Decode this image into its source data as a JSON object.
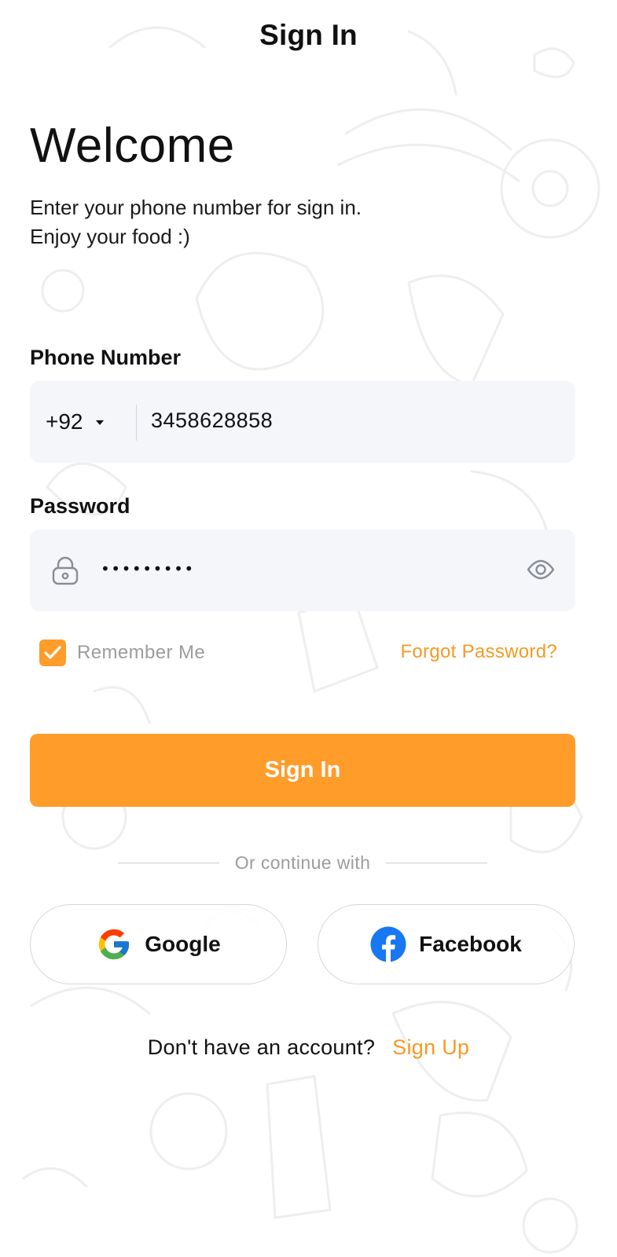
{
  "header": {
    "title": "Sign In"
  },
  "welcome": {
    "title": "Welcome",
    "subtitle": "Enter your phone number for sign in. Enjoy your food :)"
  },
  "phone": {
    "label": "Phone Number",
    "country_code": "+92",
    "value": "3458628858"
  },
  "password": {
    "label": "Password",
    "value": "•••••••••",
    "lock_icon": "lock-icon",
    "visibility_icon": "eye-icon"
  },
  "remember": {
    "label": "Remember Me",
    "checked": true
  },
  "forgot_password": {
    "label": "Forgot Password?"
  },
  "signin_button": {
    "label": "Sign In"
  },
  "divider": {
    "text": "Or continue with"
  },
  "social": {
    "google": "Google",
    "facebook": "Facebook"
  },
  "signup": {
    "prompt": "Don't have an account?",
    "link": "Sign Up"
  },
  "colors": {
    "accent": "#ff9c2a",
    "link": "#f59a24",
    "field_bg": "#f5f6fa",
    "muted_text": "#9c9c9c",
    "facebook_blue": "#1877f2"
  }
}
